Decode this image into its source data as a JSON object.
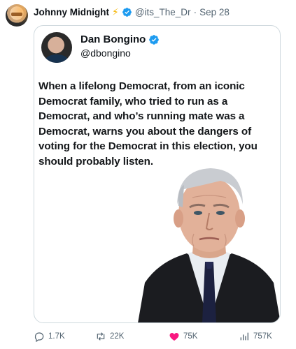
{
  "post": {
    "author": {
      "display_name": "Johnny Midnight",
      "emoji": "⚡",
      "handle": "@its_The_Dr",
      "separator": "·",
      "date": "Sep 28"
    },
    "quoted": {
      "display_name": "Dan Bongino",
      "handle": "@dbongino",
      "text": "When a lifelong Democrat, from an iconic Democrat family, who tried to run as a Democrat, and who’s running mate was a Democrat, warns you about the dangers of voting for the Democrat in this election, you should probably listen."
    },
    "actions": {
      "replies": "1.7K",
      "reposts": "22K",
      "likes": "75K",
      "views": "757K"
    }
  },
  "colors": {
    "verified": "#1d9bf0",
    "like": "#f91880",
    "muted": "#536471",
    "border": "#cfd9de"
  },
  "icons": [
    "verified-badge-icon",
    "reply-icon",
    "repost-icon",
    "like-icon",
    "views-icon",
    "lightning-icon"
  ]
}
